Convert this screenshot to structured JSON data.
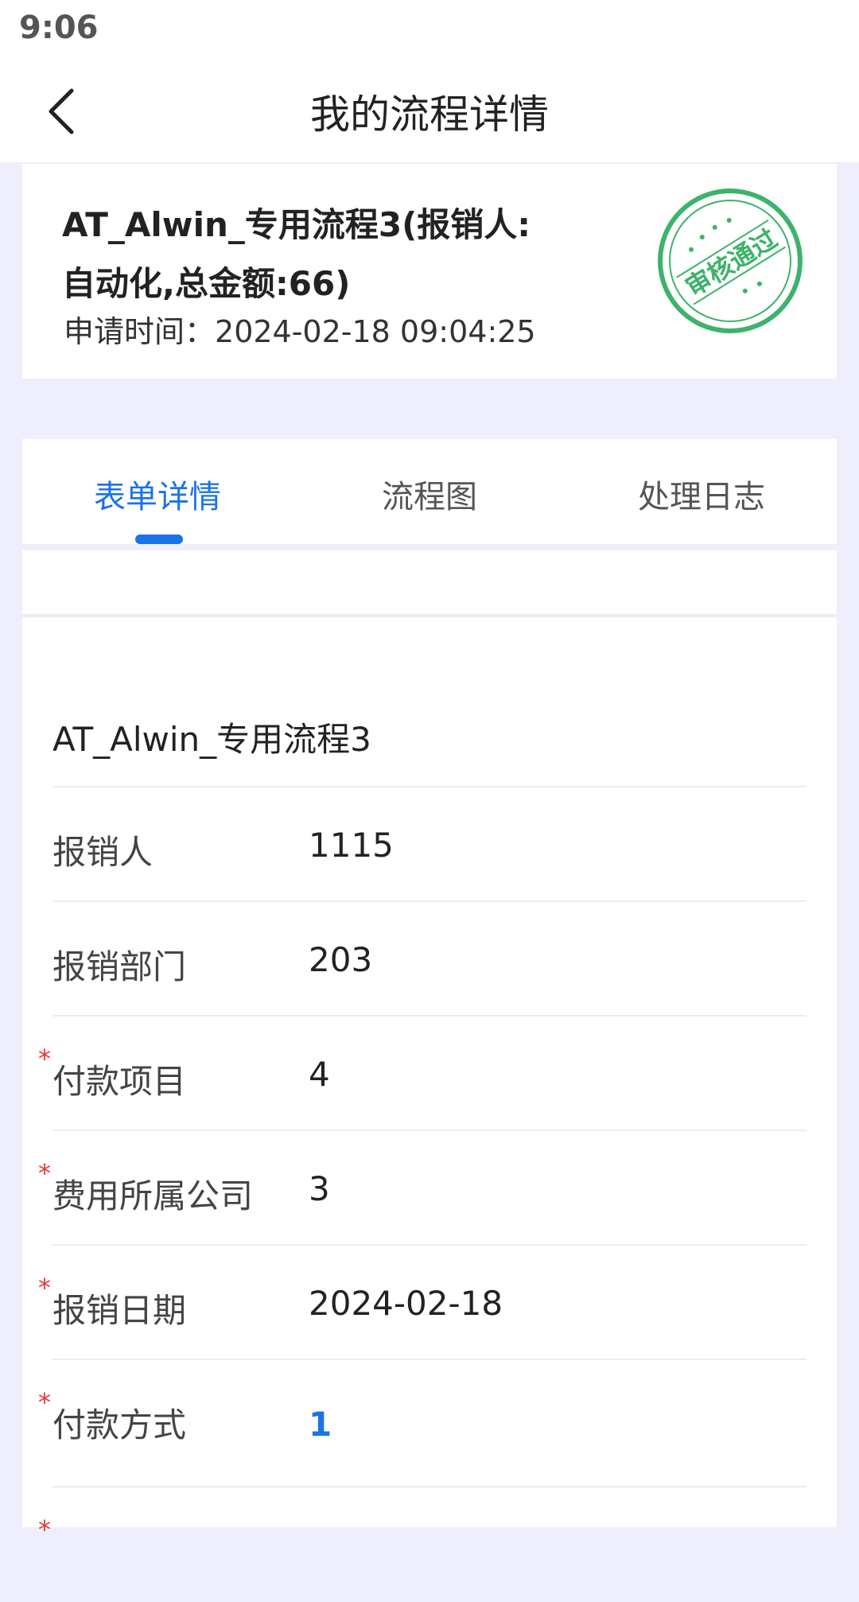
{
  "status_bar": {
    "time": "9:06"
  },
  "nav": {
    "title": "我的流程详情",
    "back_icon": "chevron-left-icon"
  },
  "request": {
    "title_line1": "AT_Alwin_专用流程3(报销人:",
    "title_line2": "自动化,总金额:66)",
    "time_label": "申请时间：",
    "time_value": "2024-02-18 09:04:25",
    "stamp_text": "审核通过",
    "stamp_color": "#3db36b"
  },
  "tabs": [
    {
      "label": "表单详情",
      "active": true
    },
    {
      "label": "流程图",
      "active": false
    },
    {
      "label": "处理日志",
      "active": false
    }
  ],
  "form": {
    "title": "AT_Alwin_专用流程3",
    "rows": [
      {
        "label": "报销人",
        "value": "1115",
        "required": false
      },
      {
        "label": "报销部门",
        "value": "203",
        "required": false
      },
      {
        "label": "付款项目",
        "value": "4",
        "required": true
      },
      {
        "label": "费用所属公司",
        "value": "3",
        "required": true
      },
      {
        "label": "报销日期",
        "value": "2024-02-18",
        "required": true
      },
      {
        "label": "付款方式",
        "value": "1",
        "required": true,
        "link": true
      }
    ],
    "required_mark": "*"
  },
  "colors": {
    "accent": "#1a73e8",
    "required": "#e53935",
    "background": "#eeeefc"
  }
}
